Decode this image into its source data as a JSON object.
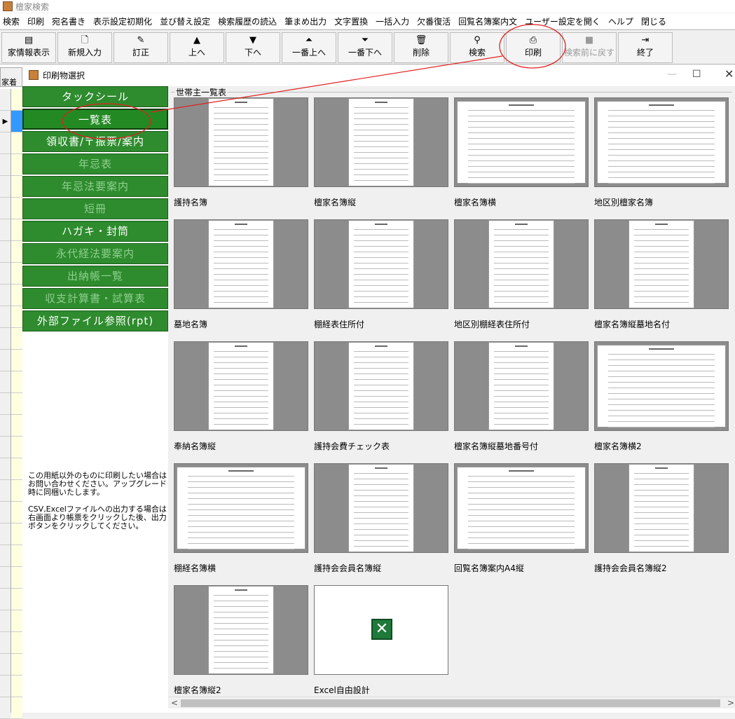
{
  "window": {
    "title": "檀家検索"
  },
  "menu": [
    "検索",
    "印刷",
    "宛名書き",
    "表示設定初期化",
    "並び替え設定",
    "検索履歴の読込",
    "筆まめ出力",
    "文字置換",
    "一括入力",
    "欠番復活",
    "回覧名簿案内文",
    "ユーザー設定を開く",
    "ヘルプ",
    "閉じる"
  ],
  "toolbar": [
    {
      "label": "家情報表示",
      "icon": "family-info-icon",
      "glyph": "▤",
      "enabled": true
    },
    {
      "label": "新規入力",
      "icon": "new-document-icon",
      "glyph": "🗋",
      "enabled": true
    },
    {
      "label": "訂正",
      "icon": "pencil-icon",
      "glyph": "✎",
      "enabled": true
    },
    {
      "label": "上へ",
      "icon": "arrow-up-icon",
      "glyph": "▲",
      "enabled": true
    },
    {
      "label": "下へ",
      "icon": "arrow-down-icon",
      "glyph": "▼",
      "enabled": true
    },
    {
      "label": "一番上へ",
      "icon": "arrow-top-icon",
      "glyph": "⏶",
      "enabled": true
    },
    {
      "label": "一番下へ",
      "icon": "arrow-bottom-icon",
      "glyph": "⏷",
      "enabled": true
    },
    {
      "label": "削除",
      "icon": "trash-icon",
      "glyph": "🗑",
      "enabled": true
    },
    {
      "label": "検索",
      "icon": "search-icon",
      "glyph": "⚲",
      "enabled": true
    },
    {
      "label": "印刷",
      "icon": "printer-icon",
      "glyph": "⎙",
      "enabled": true
    },
    {
      "label": "検索前に戻す",
      "icon": "undo-search-icon",
      "glyph": "■",
      "enabled": false
    },
    {
      "label": "終了",
      "icon": "exit-icon",
      "glyph": "⇥",
      "enabled": true
    }
  ],
  "left_strip": {
    "tab_label": "家着"
  },
  "dialog": {
    "title": "印刷物選択",
    "categories": [
      {
        "label": "タックシール",
        "style": "normal"
      },
      {
        "label": "一覧表",
        "style": "selected"
      },
      {
        "label": "領収書/〒振票/案内",
        "style": "normal"
      },
      {
        "label": "年忌表",
        "style": "dim"
      },
      {
        "label": "年忌法要案内",
        "style": "dim"
      },
      {
        "label": "短冊",
        "style": "dim"
      },
      {
        "label": "ハガキ・封筒",
        "style": "normal"
      },
      {
        "label": "永代経法要案内",
        "style": "dim"
      },
      {
        "label": "出納帳一覧",
        "style": "dim"
      },
      {
        "label": "収支計算書・試算表",
        "style": "dim"
      },
      {
        "label": "外部ファイル参照(rpt)",
        "style": "normal"
      }
    ],
    "note_1": "この用紙以外のものに印刷したい場合はお問い合わせください。アップグレード時に同梱いたします。",
    "note_2": "CSV,Excelファイルへの出力する場合は右画面より帳票をクリックした後、出力ボタンをクリックしてください。",
    "group_title": "世帯主一覧表",
    "reports": [
      {
        "name": "護持名簿",
        "layout": "portrait"
      },
      {
        "name": "檀家名簿縦",
        "layout": "portrait"
      },
      {
        "name": "檀家名簿横",
        "layout": "landscape"
      },
      {
        "name": "地区別檀家名簿",
        "layout": "landscape"
      },
      {
        "name": "墓地名簿",
        "layout": "portrait"
      },
      {
        "name": "棚経表住所付",
        "layout": "portrait"
      },
      {
        "name": "地区別棚経表住所付",
        "layout": "portrait"
      },
      {
        "name": "檀家名簿縦墓地名付",
        "layout": "portrait"
      },
      {
        "name": "奉納名簿縦",
        "layout": "portrait"
      },
      {
        "name": "護持会費チェック表",
        "layout": "portrait"
      },
      {
        "name": "檀家名簿縦墓地番号付",
        "layout": "portrait"
      },
      {
        "name": "檀家名簿横2",
        "layout": "landscape"
      },
      {
        "name": "棚経名簿横",
        "layout": "landscape"
      },
      {
        "name": "護持会会員名簿縦",
        "layout": "portrait"
      },
      {
        "name": "回覧名簿案内A4縦",
        "layout": "landscape"
      },
      {
        "name": "護持会会員名簿縦2",
        "layout": "portrait"
      },
      {
        "name": "檀家名簿縦2",
        "layout": "portrait"
      },
      {
        "name": "Excel自由設計",
        "layout": "excel"
      }
    ]
  },
  "annotation_color": "#e02020"
}
